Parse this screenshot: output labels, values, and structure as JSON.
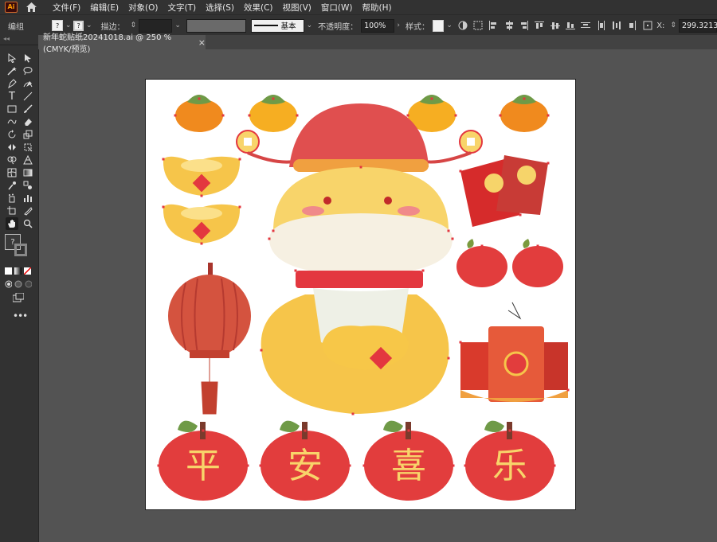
{
  "app": {
    "logo_text": "Ai"
  },
  "menu": {
    "items": [
      "文件(F)",
      "编辑(E)",
      "对象(O)",
      "文字(T)",
      "选择(S)",
      "效果(C)",
      "视图(V)",
      "窗口(W)",
      "帮助(H)"
    ]
  },
  "control_bar": {
    "selection_label": "编组",
    "fill_value": "?",
    "stroke_value": "?",
    "stroke_label": "描边：",
    "brush_label": "基本",
    "opacity_label": "不透明度：",
    "opacity_value": "100%",
    "style_label": "样式：",
    "x_label": "X:",
    "x_value": "299.3213"
  },
  "document_tab": {
    "title": "新年蛇贴纸20241018.ai @ 250 % (CMYK/预览)",
    "close": "×"
  },
  "tools": {
    "fill_stroke_unknown": "?"
  },
  "artwork": {
    "characters": [
      "平",
      "安",
      "喜",
      "乐"
    ]
  },
  "colors": {
    "accent_selection": "#e3373f",
    "workspace": "#535353",
    "panel": "#323232"
  }
}
